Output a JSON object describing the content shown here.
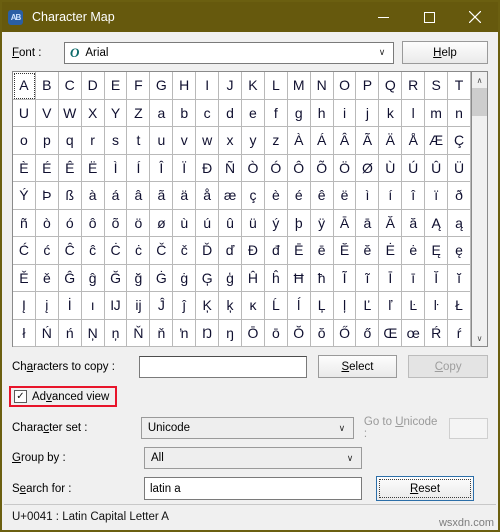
{
  "window": {
    "title": "Character Map",
    "app_icon": "character-map-icon",
    "border_color": "#6b5f10",
    "titlebar_color": "#66590d",
    "controls": {
      "minimize": "–",
      "maximize": "☐",
      "close": "✕"
    }
  },
  "font_row": {
    "label": "Font :",
    "label_pre": "F",
    "label_key": "o",
    "label_post": "nt :",
    "otf_icon": "opentype-icon",
    "value": "Arial",
    "arrow": "∨",
    "help_pre": "H",
    "help_key": "e",
    "help_post": "lp"
  },
  "grid": {
    "selected_index": 0,
    "scrollbar": {
      "up_arrow": "∧",
      "down_arrow": "∨"
    },
    "rows": [
      [
        "A",
        "B",
        "C",
        "D",
        "E",
        "F",
        "G",
        "H",
        "I",
        "J",
        "K",
        "L",
        "M",
        "N",
        "O",
        "P",
        "Q",
        "R",
        "S",
        "T"
      ],
      [
        "U",
        "V",
        "W",
        "X",
        "Y",
        "Z",
        "a",
        "b",
        "c",
        "d",
        "e",
        "f",
        "g",
        "h",
        "i",
        "j",
        "k",
        "l",
        "m",
        "n"
      ],
      [
        "o",
        "p",
        "q",
        "r",
        "s",
        "t",
        "u",
        "v",
        "w",
        "x",
        "y",
        "z",
        "À",
        "Á",
        "Â",
        "Ã",
        "Ä",
        "Å",
        "Æ",
        "Ç"
      ],
      [
        "È",
        "É",
        "Ê",
        "Ë",
        "Ì",
        "Í",
        "Î",
        "Ï",
        "Ð",
        "Ñ",
        "Ò",
        "Ó",
        "Ô",
        "Õ",
        "Ö",
        "Ø",
        "Ù",
        "Ú",
        "Û",
        "Ü"
      ],
      [
        "Ý",
        "Þ",
        "ß",
        "à",
        "á",
        "â",
        "ã",
        "ä",
        "å",
        "æ",
        "ç",
        "è",
        "é",
        "ê",
        "ë",
        "ì",
        "í",
        "î",
        "ï",
        "ð"
      ],
      [
        "ñ",
        "ò",
        "ó",
        "ô",
        "õ",
        "ö",
        "ø",
        "ù",
        "ú",
        "û",
        "ü",
        "ý",
        "þ",
        "ÿ",
        "Ā",
        "ā",
        "Ă",
        "ă",
        "Ą",
        "ą"
      ],
      [
        "Ć",
        "ć",
        "Ĉ",
        "ĉ",
        "Ċ",
        "ċ",
        "Č",
        "č",
        "Ď",
        "ď",
        "Đ",
        "đ",
        "Ē",
        "ē",
        "Ĕ",
        "ĕ",
        "Ė",
        "ė",
        "Ę",
        "ę"
      ],
      [
        "Ě",
        "ě",
        "Ĝ",
        "ĝ",
        "Ğ",
        "ğ",
        "Ġ",
        "ġ",
        "Ģ",
        "ģ",
        "Ĥ",
        "ĥ",
        "Ħ",
        "ħ",
        "Ĩ",
        "ĩ",
        "Ī",
        "ī",
        "Ĭ",
        "ĭ"
      ],
      [
        "Į",
        "į",
        "İ",
        "ı",
        "Ĳ",
        "ĳ",
        "Ĵ",
        "ĵ",
        "Ķ",
        "ķ",
        "ĸ",
        "Ĺ",
        "ĺ",
        "Ļ",
        "ļ",
        "Ľ",
        "ľ",
        "Ŀ",
        "ŀ",
        "Ł"
      ],
      [
        "ł",
        "Ń",
        "ń",
        "Ņ",
        "ņ",
        "Ň",
        "ň",
        "ŉ",
        "Ŋ",
        "ŋ",
        "Ō",
        "ō",
        "Ŏ",
        "ŏ",
        "Ő",
        "ő",
        "Œ",
        "œ",
        "Ŕ",
        "ŕ"
      ]
    ]
  },
  "copy_row": {
    "label": "Characters to copy :",
    "value": "",
    "placeholder": "",
    "select_label": "Select",
    "copy_label": "Copy",
    "copy_disabled": true
  },
  "advanced": {
    "label": "Advanced view",
    "checked": true,
    "check_glyph": "✓",
    "highlight_color": "#e8142a"
  },
  "charset_row": {
    "label": "Character set :",
    "value": "Unicode",
    "arrow": "∨",
    "goto_label": "Go to Unicode :",
    "goto_value": "",
    "goto_disabled": true
  },
  "groupby_row": {
    "label": "Group by :",
    "value": "All",
    "arrow": "∨"
  },
  "search_row": {
    "label": "Search for :",
    "value": "latin a",
    "placeholder": "",
    "reset_label": "Reset"
  },
  "statusbar": {
    "text": "U+0041 : Latin Capital Letter A"
  },
  "watermark": {
    "text": "wsxdn.com"
  }
}
